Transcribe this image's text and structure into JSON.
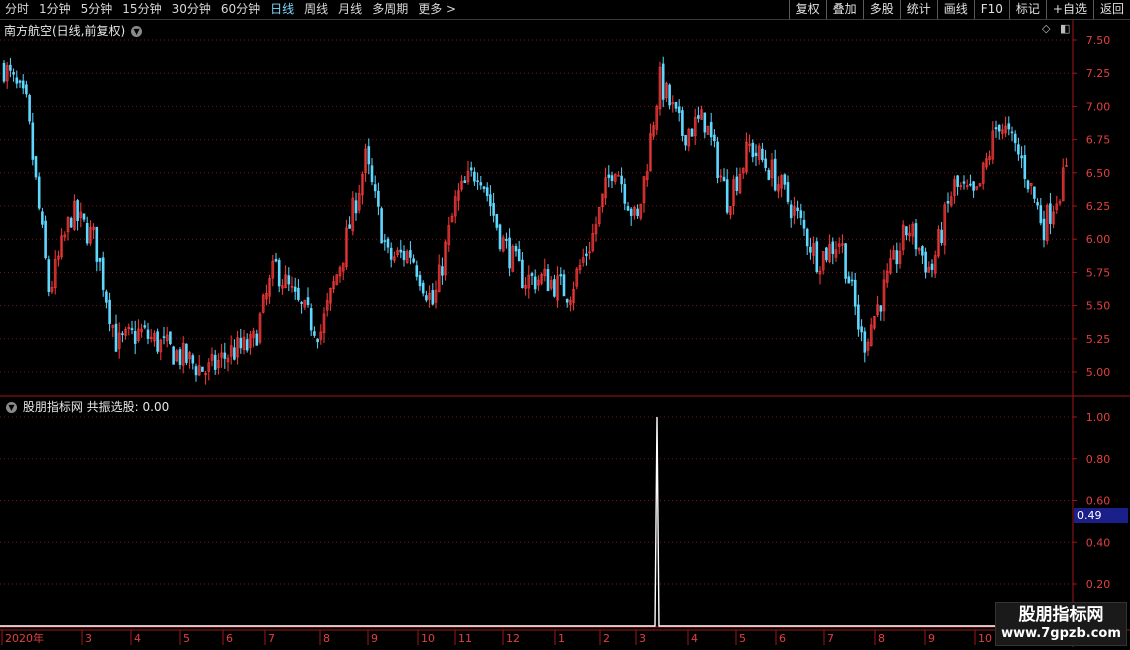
{
  "toolbar": {
    "periods": [
      "分时",
      "1分钟",
      "5分钟",
      "15分钟",
      "30分钟",
      "60分钟",
      "日线",
      "周线",
      "月线",
      "多周期",
      "更多 >"
    ],
    "active_period": "日线",
    "tools": [
      "复权",
      "叠加",
      "多股",
      "统计",
      "画线",
      "F10",
      "标记",
      "+自选",
      "返回"
    ]
  },
  "main_panel": {
    "stock_title": "南方航空(日线,前复权)",
    "chevron": "chevron-down-icon"
  },
  "sub_panel": {
    "indicator_title": "股朋指标网 共振选股: 0.00",
    "value_box": "0.49"
  },
  "watermark": {
    "line1": "股朋指标网",
    "line2": "www.7gpzb.com"
  },
  "colors": {
    "up": "#ff3b3b",
    "down": "#5fd8ff",
    "grid": "#7a1414",
    "axis": "#a01818",
    "signal": "#ffffff"
  },
  "chart_data": [
    {
      "type": "candlestick",
      "title": "南方航空(日线,前复权)",
      "ylim": [
        4.9,
        7.6
      ],
      "yticks": [
        "7.50",
        "7.25",
        "7.00",
        "6.75",
        "6.50",
        "6.25",
        "6.00",
        "5.75",
        "5.50",
        "5.25",
        "5.00"
      ],
      "x_month_labels": [
        "2020年",
        "3",
        "4",
        "5",
        "6",
        "7",
        "8",
        "9",
        "10",
        "11",
        "12",
        "1",
        "2",
        "3",
        "4",
        "5",
        "6",
        "7",
        "8",
        "9",
        "10"
      ],
      "close_path": [
        {
          "m": "2020-01",
          "close": 7.3
        },
        {
          "m": "2020-01",
          "close": 7.0
        },
        {
          "m": "2020-02",
          "close": 5.6
        },
        {
          "m": "2020-02",
          "close": 6.2
        },
        {
          "m": "2020-03",
          "close": 6.0
        },
        {
          "m": "2020-03",
          "close": 5.2
        },
        {
          "m": "2020-04",
          "close": 5.3
        },
        {
          "m": "2020-04",
          "close": 5.2
        },
        {
          "m": "2020-05",
          "close": 5.1
        },
        {
          "m": "2020-05",
          "close": 5.0
        },
        {
          "m": "2020-06",
          "close": 5.15
        },
        {
          "m": "2020-06",
          "close": 5.2
        },
        {
          "m": "2020-07",
          "close": 5.8
        },
        {
          "m": "2020-07",
          "close": 5.5
        },
        {
          "m": "2020-08",
          "close": 5.3
        },
        {
          "m": "2020-08",
          "close": 5.9
        },
        {
          "m": "2020-09",
          "close": 6.6
        },
        {
          "m": "2020-09",
          "close": 5.85
        },
        {
          "m": "2020-10",
          "close": 5.9
        },
        {
          "m": "2020-10",
          "close": 5.5
        },
        {
          "m": "2020-11",
          "close": 6.3
        },
        {
          "m": "2020-11",
          "close": 6.55
        },
        {
          "m": "2020-12",
          "close": 6.0
        },
        {
          "m": "2020-12",
          "close": 5.7
        },
        {
          "m": "2021-01",
          "close": 5.7
        },
        {
          "m": "2021-01",
          "close": 5.6
        },
        {
          "m": "2021-02",
          "close": 6.0
        },
        {
          "m": "2021-02",
          "close": 6.6
        },
        {
          "m": "2021-03",
          "close": 6.1
        },
        {
          "m": "2021-03",
          "close": 7.2
        },
        {
          "m": "2021-04",
          "close": 6.8
        },
        {
          "m": "2021-04",
          "close": 6.9
        },
        {
          "m": "2021-05",
          "close": 6.3
        },
        {
          "m": "2021-05",
          "close": 6.7
        },
        {
          "m": "2021-06",
          "close": 6.5
        },
        {
          "m": "2021-06",
          "close": 6.2
        },
        {
          "m": "2021-07",
          "close": 5.85
        },
        {
          "m": "2021-07",
          "close": 6.0
        },
        {
          "m": "2021-08",
          "close": 5.2
        },
        {
          "m": "2021-08",
          "close": 5.65
        },
        {
          "m": "2021-09",
          "close": 6.1
        },
        {
          "m": "2021-09",
          "close": 5.75
        },
        {
          "m": "2021-10",
          "close": 6.4
        },
        {
          "m": "2021-10",
          "close": 6.3
        },
        {
          "m": "2021-11",
          "close": 6.9
        },
        {
          "m": "2021-11",
          "close": 6.6
        },
        {
          "m": "2021-12",
          "close": 6.1
        },
        {
          "m": "2021-12",
          "close": 6.5
        }
      ]
    },
    {
      "type": "line",
      "title": "股朋指标网 共振选股",
      "ylim": [
        0,
        1.1
      ],
      "yticks": [
        "1.00",
        "0.80",
        "0.60",
        "0.40",
        "0.20"
      ],
      "signal": {
        "m": "2021-03",
        "value": 1.0
      },
      "current_value": 0.0
    }
  ]
}
